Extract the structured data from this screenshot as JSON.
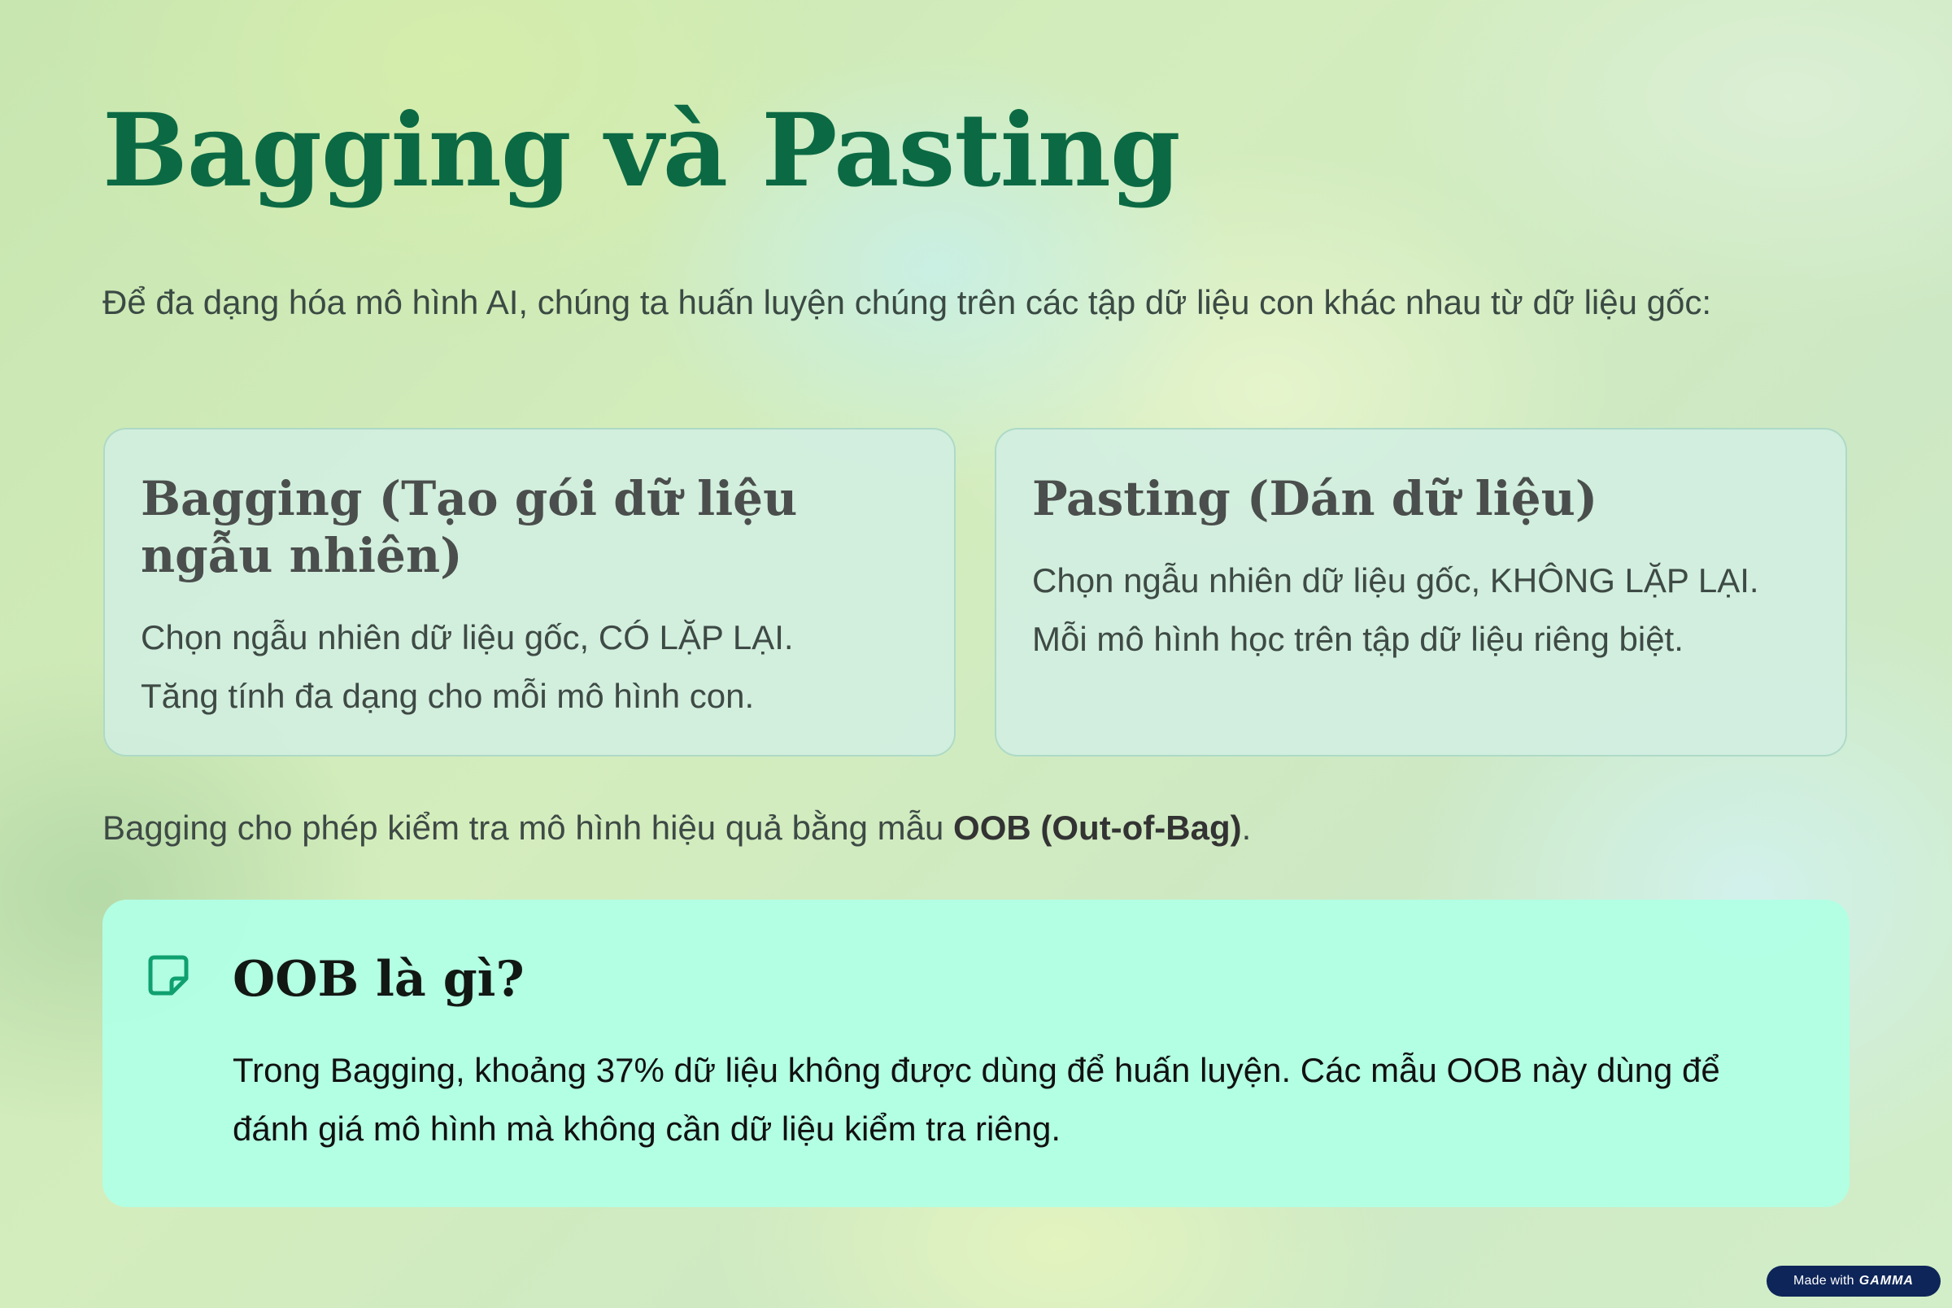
{
  "slide": {
    "title": "Bagging và Pasting",
    "intro": "Để đa dạng hóa mô hình AI, chúng ta huấn luyện chúng trên các tập dữ liệu con khác nhau từ dữ liệu gốc:"
  },
  "cards": [
    {
      "title": "Bagging (Tạo gói dữ liệu ngẫu nhiên)",
      "line1": "Chọn ngẫu nhiên dữ liệu gốc, CÓ LẶP LẠI.",
      "line2": "Tăng tính đa dạng cho mỗi mô hình con."
    },
    {
      "title": "Pasting (Dán dữ liệu)",
      "line1": "Chọn ngẫu nhiên dữ liệu gốc, KHÔNG LẶP LẠI.",
      "line2": "Mỗi mô hình học trên tập dữ liệu riêng biệt."
    }
  ],
  "note": {
    "text_before": "Bagging cho phép kiểm tra mô hình hiệu quả bằng mẫu ",
    "bold": "OOB (Out-of-Bag)",
    "text_after": "."
  },
  "callout": {
    "icon": "sticky-note-icon",
    "title": "OOB là gì?",
    "body": "Trong Bagging, khoảng 37% dữ liệu không được dùng để huấn luyện. Các mẫu OOB này dùng để đánh giá mô hình mà không cần dữ liệu kiểm tra riêng."
  },
  "badge": {
    "prefix": "Made with",
    "brand": "GAMMA"
  },
  "colors": {
    "title": "#0b6a44",
    "callout_bg": "#b2ffe4",
    "icon": "#10a070",
    "badge_bg": "#0d2558"
  }
}
